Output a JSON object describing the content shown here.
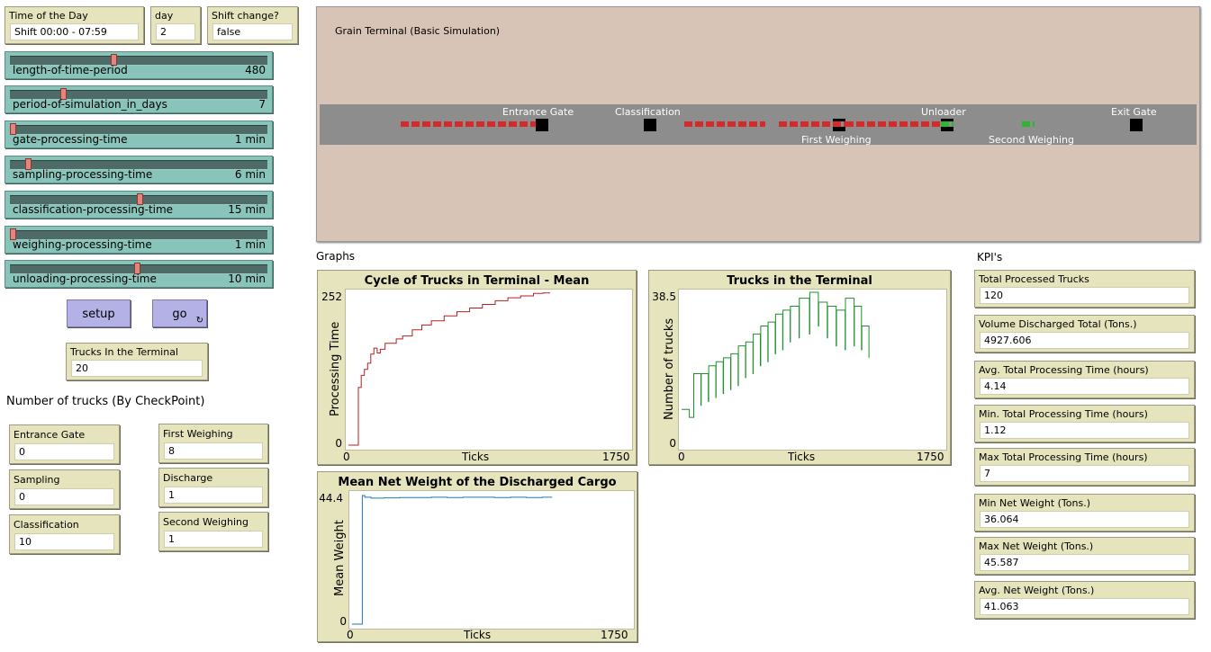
{
  "header": {
    "time_of_day": {
      "label": "Time of the Day",
      "value": "Shift 00:00 - 07:59"
    },
    "day": {
      "label": "day",
      "value": "2"
    },
    "shift_change": {
      "label": "Shift change?",
      "value": "false"
    }
  },
  "sliders": [
    {
      "name": "length-of-time-period",
      "value": "480",
      "level": 0.4
    },
    {
      "name": "period-of-simulation_in_days",
      "value": "7",
      "level": 0.2
    },
    {
      "name": "gate-processing-time",
      "value": "1 min",
      "level": 0.0
    },
    {
      "name": "sampling-processing-time",
      "value": "6 min",
      "level": 0.06
    },
    {
      "name": "classification-processing-time",
      "value": "15 min",
      "level": 0.5
    },
    {
      "name": "weighing-processing-time",
      "value": "1 min",
      "level": 0.0
    },
    {
      "name": "unloading-processing-time",
      "value": "10 min",
      "level": 0.49
    }
  ],
  "buttons": {
    "setup": "setup",
    "go": "go"
  },
  "trucks_in_terminal": {
    "label": "Trucks In the Terminal",
    "value": "20"
  },
  "checkpoint_title": "Number of trucks (By CheckPoint)",
  "checkpoints": [
    {
      "label": "Entrance Gate",
      "value": "0"
    },
    {
      "label": "Sampling",
      "value": "0"
    },
    {
      "label": "Classification",
      "value": "10"
    },
    {
      "label": "First Weighing",
      "value": "8"
    },
    {
      "label": "Discharge",
      "value": "1"
    },
    {
      "label": "Second Weighing",
      "value": "1"
    }
  ],
  "world": {
    "title": "Grain Terminal (Basic Simulation)",
    "labels": {
      "entrance_gate": "Entrance Gate",
      "classification": "Classification",
      "unloader": "Unloader",
      "exit_gate": "Exit Gate",
      "first_weighing": "First Weighing",
      "second_weighing": "Second Weighing"
    },
    "colors": {
      "background": "#d8c4b6",
      "road": "#8d8d8d",
      "truck_waiting": "#d42a2a",
      "truck_loaded": "#2db52d"
    }
  },
  "graphs_title": "Graphs",
  "kpi_title": "KPI's",
  "kpis": [
    {
      "label": "Total Processed Trucks",
      "value": "120"
    },
    {
      "label": "Volume Discharged Total (Tons.)",
      "value": "4927.606"
    },
    {
      "label": "Avg. Total Processing Time (hours)",
      "value": "4.14"
    },
    {
      "label": "Min. Total Processing Time (hours)",
      "value": "1.12"
    },
    {
      "label": "Max Total Processing Time (hours)",
      "value": "7"
    },
    {
      "label": "Min Net Weight (Tons.)",
      "value": "36.064"
    },
    {
      "label": "Max Net Weight (Tons.)",
      "value": "45.587"
    },
    {
      "label": "Avg. Net Weight (Tons.)",
      "value": "41.063"
    }
  ],
  "chart_data": [
    {
      "type": "line",
      "title": "Cycle of Trucks in Terminal - Mean",
      "xlabel": "Ticks",
      "ylabel": "Processing Time",
      "xlim": [
        0,
        1750
      ],
      "ylim": [
        0,
        252
      ],
      "x_ticks": [
        "0",
        "1750"
      ],
      "y_ticks": [
        "0",
        "252"
      ],
      "color": "#b22222",
      "x": [
        0,
        60,
        62,
        80,
        100,
        120,
        140,
        160,
        180,
        200,
        230,
        260,
        300,
        340,
        400,
        460,
        520,
        600,
        680,
        760,
        840,
        920,
        1000,
        1080,
        1160,
        1220,
        1260
      ],
      "y": [
        0,
        0,
        95,
        115,
        125,
        135,
        150,
        160,
        152,
        158,
        168,
        168,
        175,
        180,
        190,
        198,
        205,
        213,
        220,
        226,
        232,
        238,
        243,
        246,
        250,
        251,
        252
      ]
    },
    {
      "type": "line",
      "title": "Trucks in the Terminal",
      "xlabel": "Ticks",
      "ylabel": "Number of trucks",
      "xlim": [
        0,
        1750
      ],
      "ylim": [
        0,
        38.5
      ],
      "x_ticks": [
        "0",
        "1750"
      ],
      "y_ticks": [
        "0",
        "38.5"
      ],
      "color": "#1f8f2f",
      "x": [
        0,
        50,
        52,
        80,
        82,
        130,
        132,
        180,
        182,
        230,
        232,
        280,
        282,
        330,
        332,
        380,
        382,
        430,
        432,
        480,
        482,
        530,
        532,
        580,
        582,
        630,
        632,
        680,
        682,
        730,
        732,
        790,
        792,
        860,
        862,
        920,
        922,
        980,
        982,
        1040,
        1042,
        1100,
        1102,
        1160,
        1162,
        1210,
        1212,
        1260
      ],
      "y": [
        9,
        9,
        7,
        7,
        18,
        10,
        18,
        11,
        20,
        12,
        21,
        13,
        22,
        14,
        23,
        15,
        25,
        17,
        26,
        18,
        28,
        20,
        30,
        21,
        31,
        23,
        33,
        24,
        34,
        26,
        35,
        27,
        37,
        28,
        38.5,
        30,
        36,
        27,
        35,
        25,
        34,
        24,
        37,
        25,
        35,
        24,
        30,
        22
      ]
    },
    {
      "type": "line",
      "title": "Mean Net Weight of the Discharged Cargo",
      "xlabel": "Ticks",
      "ylabel": "Mean Weight",
      "xlim": [
        0,
        1750
      ],
      "ylim": [
        0,
        44.4
      ],
      "x_ticks": [
        "0",
        "1750"
      ],
      "y_ticks": [
        "0",
        "44.4"
      ],
      "color": "#1f77b4",
      "x": [
        0,
        60,
        65,
        80,
        120,
        200,
        300,
        400,
        500,
        600,
        700,
        800,
        900,
        1000,
        1100,
        1200,
        1260
      ],
      "y": [
        0,
        0,
        43.8,
        43.2,
        42.9,
        43.0,
        43.1,
        43.1,
        43.2,
        43.1,
        43.2,
        43.2,
        43.1,
        43.2,
        43.1,
        43.2,
        43.1
      ]
    }
  ]
}
